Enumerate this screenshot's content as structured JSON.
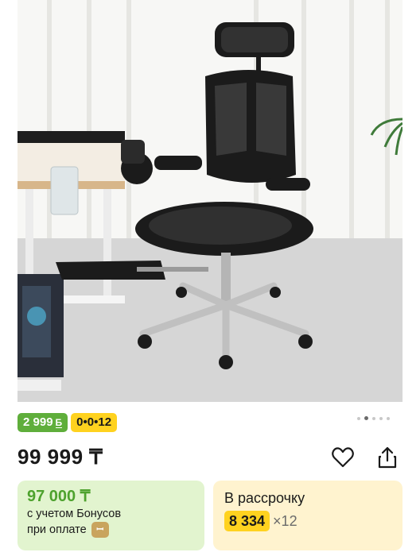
{
  "product": {
    "image_alt": "Ergonomic office chair",
    "carousel": {
      "total": 5,
      "active": 1
    },
    "bonus_badge": {
      "value": "2 999",
      "icon": "bonus-b-icon"
    },
    "installment_badge": "0•0•12",
    "price": "99 999 ₸",
    "actions": {
      "favorite_icon": "heart-icon",
      "share_icon": "share-icon"
    }
  },
  "bonus_card": {
    "price": "97 000 ₸",
    "note_line1": "с учетом Бонусов",
    "note_line2": "при оплате"
  },
  "installment_card": {
    "title": "В рассрочку",
    "monthly": "8 334",
    "months": "×12"
  },
  "colors": {
    "bonus_green": "#5fae3b",
    "accent_yellow": "#ffd21f",
    "bonus_card_bg": "#e2f4cf",
    "installment_card_bg": "#fff3cf"
  }
}
